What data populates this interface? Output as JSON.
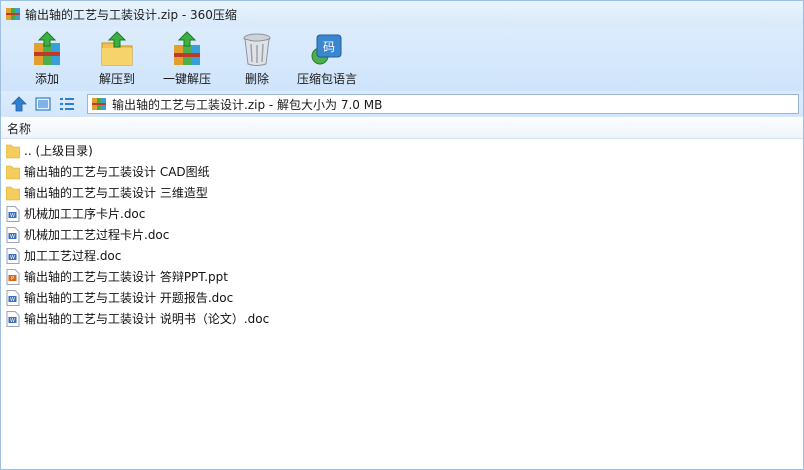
{
  "window": {
    "title": "输出轴的工艺与工装设计.zip - 360压缩"
  },
  "toolbar": {
    "buttons": [
      {
        "label": "添加",
        "icon": "add-archive-icon"
      },
      {
        "label": "解压到",
        "icon": "extract-to-icon"
      },
      {
        "label": "一键解压",
        "icon": "one-click-extract-icon"
      },
      {
        "label": "删除",
        "icon": "trash-can-icon"
      },
      {
        "label": "压缩包语言",
        "icon": "archive-language-icon"
      }
    ]
  },
  "navbar": {
    "path_text": "输出轴的工艺与工装设计.zip - 解包大小为 7.0 MB"
  },
  "columns": {
    "name": "名称"
  },
  "files": [
    {
      "name": ".. (上级目录)",
      "type": "folder"
    },
    {
      "name": "输出轴的工艺与工装设计 CAD图纸",
      "type": "folder"
    },
    {
      "name": "输出轴的工艺与工装设计 三维造型",
      "type": "folder"
    },
    {
      "name": "机械加工工序卡片.doc",
      "type": "doc"
    },
    {
      "name": "机械加工工艺过程卡片.doc",
      "type": "doc"
    },
    {
      "name": "加工工艺过程.doc",
      "type": "doc"
    },
    {
      "name": "输出轴的工艺与工装设计 答辩PPT.ppt",
      "type": "ppt"
    },
    {
      "name": "输出轴的工艺与工装设计 开题报告.doc",
      "type": "doc"
    },
    {
      "name": "输出轴的工艺与工装设计 说明书（论文）.doc",
      "type": "doc"
    }
  ],
  "colors": {
    "chrome_top": "#dcecfc",
    "chrome_bottom": "#cfe4fb",
    "folder": "#f5cd5d",
    "doc_blue": "#3c6fb8",
    "ppt_orange": "#d2691e"
  }
}
